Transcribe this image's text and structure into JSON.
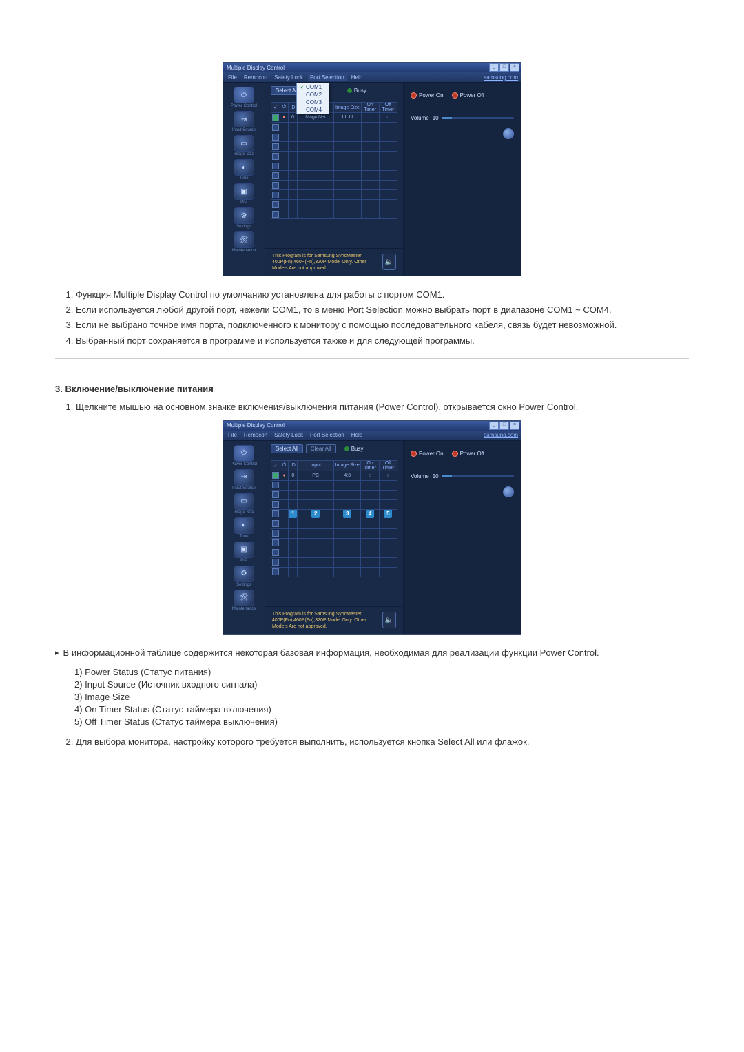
{
  "app": {
    "title": "Multiple Display Control",
    "btn_min": "_",
    "btn_max": "□",
    "btn_close": "×",
    "link": "samsung.com",
    "footer": "This Program is for Samsung SyncMaster 400P(Fn),460P(Fn),320P  Model Only. Other Models Are not approved."
  },
  "menu": {
    "file": "File",
    "remocon": "Remocon",
    "safety": "Safety Lock",
    "port": "Port Selection",
    "help": "Help"
  },
  "port_dd": {
    "com1": "COM1",
    "com2": "COM2",
    "com3": "COM3",
    "com4": "COM4"
  },
  "sidebar": {
    "power": "Power Control",
    "input": "Input Source",
    "image": "Image Size",
    "time": "Time",
    "pip": "PIP",
    "settings": "Settings",
    "maint": "Maintenance"
  },
  "toolbar": {
    "select_all": "Select All",
    "clear_all": "Clear All",
    "busy": "Busy"
  },
  "grid": {
    "h_id": "ID",
    "h_input": "Input",
    "h_size": "Image Size",
    "h_on": "On Timer",
    "h_off": "Off Timer",
    "r1_input": "MagicNet",
    "r1_size": "IIII  III",
    "r1_on": "○",
    "r1_off": "○",
    "r2_input": "PC",
    "r2_size": "4:3",
    "r2_on": "○",
    "r2_off": "○"
  },
  "panel": {
    "power_on": "Power On",
    "power_off": "Power Off",
    "volume": "Volume",
    "volume_val": "10"
  },
  "badge": {
    "n1": "1",
    "n2": "2",
    "n3": "3",
    "n4": "4",
    "n5": "5"
  },
  "doc": {
    "list1_1": "Функция Multiple Display Control по умолчанию установлена для работы с портом COM1.",
    "list1_2": "Если используется любой другой порт, нежели COM1, то в меню Port Selection можно выбрать порт в диапазоне COM1 ~ COM4.",
    "list1_3": "Если не выбрано точное имя порта, подключенного к монитору с помощью последовательного кабеля, связь будет невозможной.",
    "list1_4": "Выбранный порт сохраняется в программе и используется также и для следующей программы.",
    "section3": "3. Включение/выключение питания",
    "s3_1": "Щелкните мышью на основном значке включения/выключения питания (Power Control), открывается окно Power Control.",
    "arrow_text": "В информационной таблице содержится некоторая базовая информация, необходимая для реализации функции Power Control.",
    "lg1": "1) Power Status (Статус питания)",
    "lg2": "2) Input Source (Источник входного сигнала)",
    "lg3": "3) Image Size",
    "lg4": "4) On Timer Status (Статус таймера включения)",
    "lg5": "5) Off Timer Status (Статус таймера выключения)",
    "s3_2": "Для выбора монитора, настройку которого требуется выполнить, используется кнопка Select All или флажок."
  }
}
